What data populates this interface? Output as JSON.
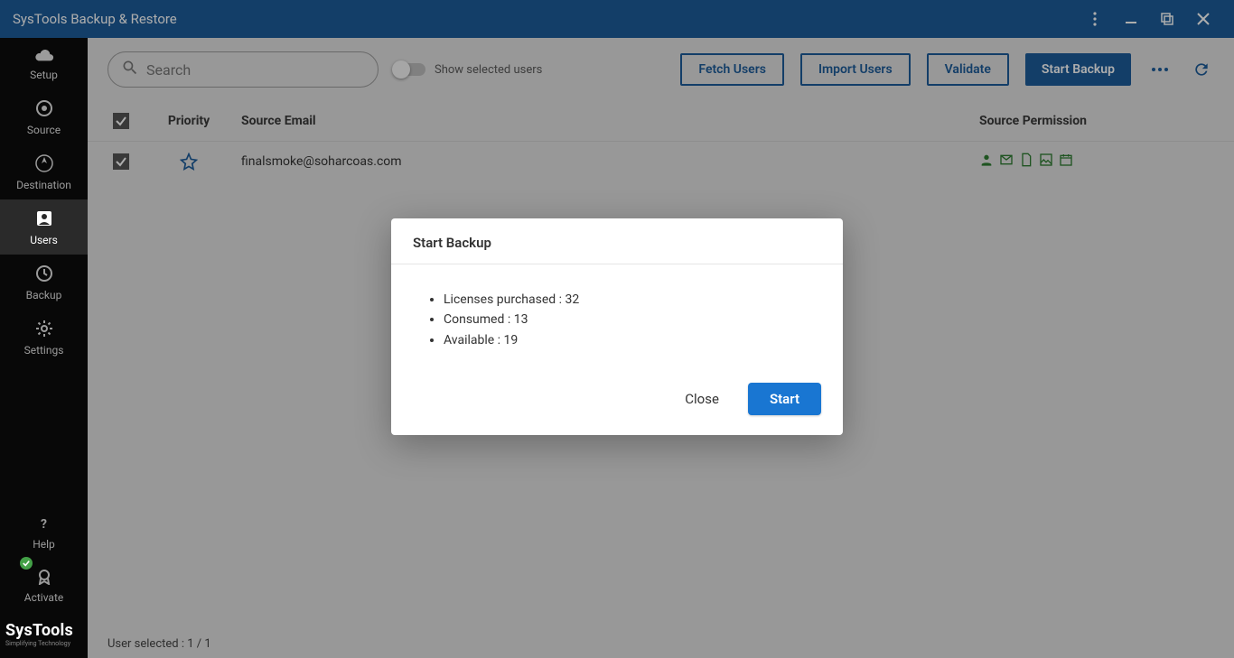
{
  "title": "SysTools Backup & Restore",
  "sidebar": {
    "items": [
      {
        "label": "Setup"
      },
      {
        "label": "Source"
      },
      {
        "label": "Destination"
      },
      {
        "label": "Users"
      },
      {
        "label": "Backup"
      },
      {
        "label": "Settings"
      }
    ],
    "help": "Help",
    "activate": "Activate",
    "brand": "SysTools",
    "brand_tag": "Simplifying Technology"
  },
  "toolbar": {
    "search_placeholder": "Search",
    "toggle_label": "Show selected users",
    "fetch": "Fetch Users",
    "import": "Import Users",
    "validate": "Validate",
    "start_backup": "Start Backup"
  },
  "table": {
    "headers": {
      "priority": "Priority",
      "email": "Source Email",
      "permission": "Source Permission"
    },
    "rows": [
      {
        "email": "finalsmoke@soharcoas.com"
      }
    ]
  },
  "status": "User selected : 1 / 1",
  "modal": {
    "title": "Start Backup",
    "lines": {
      "l1": "Licenses purchased : 32",
      "l2": "Consumed : 13",
      "l3": "Available : 19"
    },
    "close": "Close",
    "start": "Start"
  }
}
